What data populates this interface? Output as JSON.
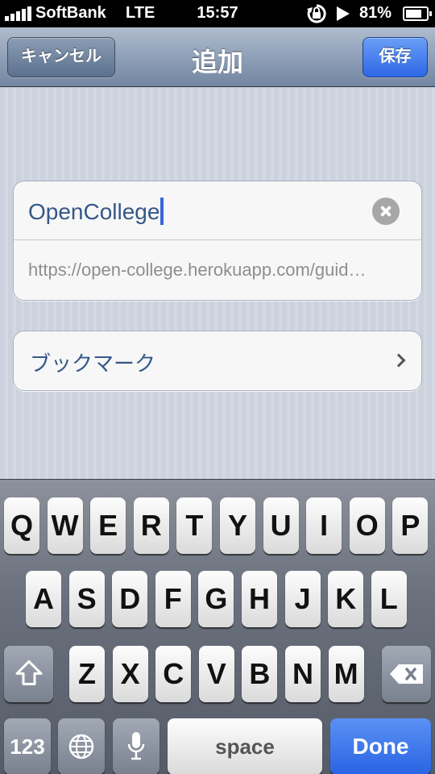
{
  "status_bar": {
    "carrier": "SoftBank",
    "network": "LTE",
    "time": "15:57",
    "battery_percent": "81%",
    "battery_level": 0.81,
    "icons": [
      "signal-icon",
      "orientation-lock-icon",
      "play-icon",
      "battery-icon"
    ]
  },
  "nav": {
    "title": "追加",
    "cancel_label": "キャンセル",
    "save_label": "保存"
  },
  "form": {
    "title_value": "OpenCollege",
    "url_value": "https://open-college.herokuapp.com/guid…",
    "clear_icon": "clear-icon"
  },
  "bookmark": {
    "label": "ブックマーク",
    "icon": "chevron-right-icon"
  },
  "keyboard": {
    "row1": [
      "Q",
      "W",
      "E",
      "R",
      "T",
      "Y",
      "U",
      "I",
      "O",
      "P"
    ],
    "row2": [
      "A",
      "S",
      "D",
      "F",
      "G",
      "H",
      "J",
      "K",
      "L"
    ],
    "row3": [
      "Z",
      "X",
      "C",
      "V",
      "B",
      "N",
      "M"
    ],
    "numbers_label": "123",
    "space_label": "space",
    "done_label": "Done",
    "icons": [
      "shift-icon",
      "backspace-icon",
      "globe-icon",
      "microphone-icon"
    ]
  },
  "colors": {
    "accent_blue": "#2d67e5",
    "text_blue": "#355789",
    "nav_bar": "#8fa0b8"
  }
}
